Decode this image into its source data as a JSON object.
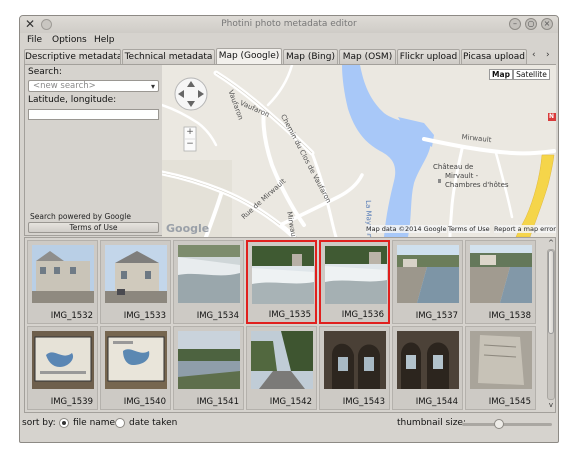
{
  "window": {
    "title": "Photini photo metadata editor",
    "close_glyph": "×",
    "min_glyph": "–",
    "max_glyph": "○"
  },
  "menu": [
    "File",
    "Options",
    "Help"
  ],
  "tabs": [
    {
      "label": "Descriptive metadata",
      "active": false
    },
    {
      "label": "Technical metadata",
      "active": false
    },
    {
      "label": "Map (Google)",
      "active": true
    },
    {
      "label": "Map (Bing)",
      "active": false
    },
    {
      "label": "Map (OSM)",
      "active": false
    },
    {
      "label": "Flickr upload",
      "active": false
    },
    {
      "label": "Picasa upload",
      "active": false
    }
  ],
  "tab_scroll": {
    "left": "‹",
    "right": "›"
  },
  "left_panel": {
    "search_label": "Search:",
    "search_placeholder": "<new search>",
    "latlng_label": "Latitude, longitude:",
    "latlng_value": "",
    "powered_by": "Search powered by Google",
    "terms_button": "Terms of Use"
  },
  "map": {
    "type_buttons": [
      "Map",
      "Satellite"
    ],
    "selected_type": "Map",
    "logo": "Google",
    "footer": {
      "data": "Map data ©2014 Google",
      "terms": "Terms of Use",
      "report": "Report a map error"
    },
    "labels": {
      "vaufaron1": "Vaufaron",
      "vaufaron2": "Vaufaron",
      "chemin": "Chemin du Clos de Vaufaron",
      "rue": "Rue de Mirwault",
      "mirwault_v": "Mirwault",
      "mirwault": "Mirwault",
      "chateau1": "Château de",
      "chateau2": "Mirvault -",
      "chateau3": "Chambres d'hôtes",
      "river": "La Mayenne",
      "road_badge": "N"
    },
    "zoom_in": "+",
    "zoom_out": "−"
  },
  "gallery": {
    "items": [
      {
        "name": "IMG_1532",
        "selected": false,
        "scene": "building"
      },
      {
        "name": "IMG_1533",
        "selected": false,
        "scene": "building2"
      },
      {
        "name": "IMG_1534",
        "selected": false,
        "scene": "weir"
      },
      {
        "name": "IMG_1535",
        "selected": true,
        "scene": "weir2"
      },
      {
        "name": "IMG_1536",
        "selected": true,
        "scene": "weir3"
      },
      {
        "name": "IMG_1537",
        "selected": false,
        "scene": "lock"
      },
      {
        "name": "IMG_1538",
        "selected": false,
        "scene": "lock2"
      },
      {
        "name": "IMG_1539",
        "selected": false,
        "scene": "sign"
      },
      {
        "name": "IMG_1540",
        "selected": false,
        "scene": "sign2"
      },
      {
        "name": "IMG_1541",
        "selected": false,
        "scene": "river"
      },
      {
        "name": "IMG_1542",
        "selected": false,
        "scene": "path"
      },
      {
        "name": "IMG_1543",
        "selected": false,
        "scene": "arch"
      },
      {
        "name": "IMG_1544",
        "selected": false,
        "scene": "arch2"
      },
      {
        "name": "IMG_1545",
        "selected": false,
        "scene": "stone"
      }
    ],
    "scroll_up": "^",
    "scroll_down": "v"
  },
  "status": {
    "sort_by": "sort by:",
    "file_name": "file name",
    "date_taken": "date taken",
    "selected_sort": "file name",
    "thumbnail_size": "thumbnail size:",
    "thumbnail_level": 0.4
  },
  "colors": {
    "selection": "#e0201e",
    "river": "#a8c8f8",
    "road_major": "#f5d54a"
  }
}
